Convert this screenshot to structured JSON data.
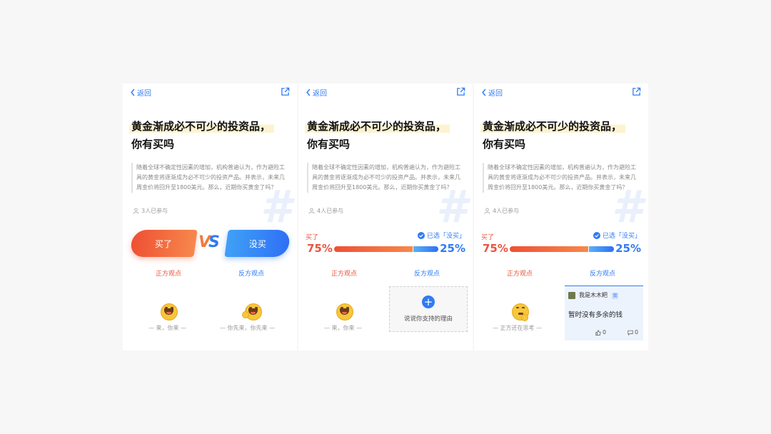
{
  "common": {
    "back_label": "返回",
    "title_line1": "黄金渐成必不可少的投资品，",
    "title_line2": "你有买吗",
    "description": "随着全球不确定性因素的增加，机构普遍认为，作为避险工具的黄金将逐渐成为必不可少的投资产品。并表示，未来几周金价将回升至1800美元。那么，近期你买黄金了吗？",
    "hash_symbol": "#",
    "side_a_label": "正方观点",
    "side_b_label": "反方观点"
  },
  "panel1": {
    "participants": "3人已参与",
    "buy_button": "买了",
    "nobuy_button": "没买",
    "vs_v": "V",
    "vs_s": "S",
    "caption_a": "— 来，你来 —",
    "caption_b": "— 你先来，你先来 —"
  },
  "panel2": {
    "participants": "4人已参与",
    "buy_label": "买了",
    "selected_note": "已选「没买」",
    "pct_buy": "75%",
    "pct_nobuy": "25%",
    "buy_fraction": 0.75,
    "caption_a": "— 来，你来 —",
    "reason_plus": "+",
    "reason_prompt": "说说你支持的理由"
  },
  "panel3": {
    "participants": "4人已参与",
    "buy_label": "买了",
    "selected_note": "已选「没买」",
    "pct_buy": "75%",
    "pct_nobuy": "25%",
    "buy_fraction": 0.75,
    "caption_a": "— 正方还在思考 —",
    "comment": {
      "user": "我是木木粑",
      "tag": "我",
      "body": "暂时没有多余的钱",
      "likes": "0",
      "comments": "0"
    }
  },
  "colors": {
    "accent_blue": "#2f7bf5",
    "accent_red": "#e9553d",
    "highlight": "#fdf3d1"
  }
}
